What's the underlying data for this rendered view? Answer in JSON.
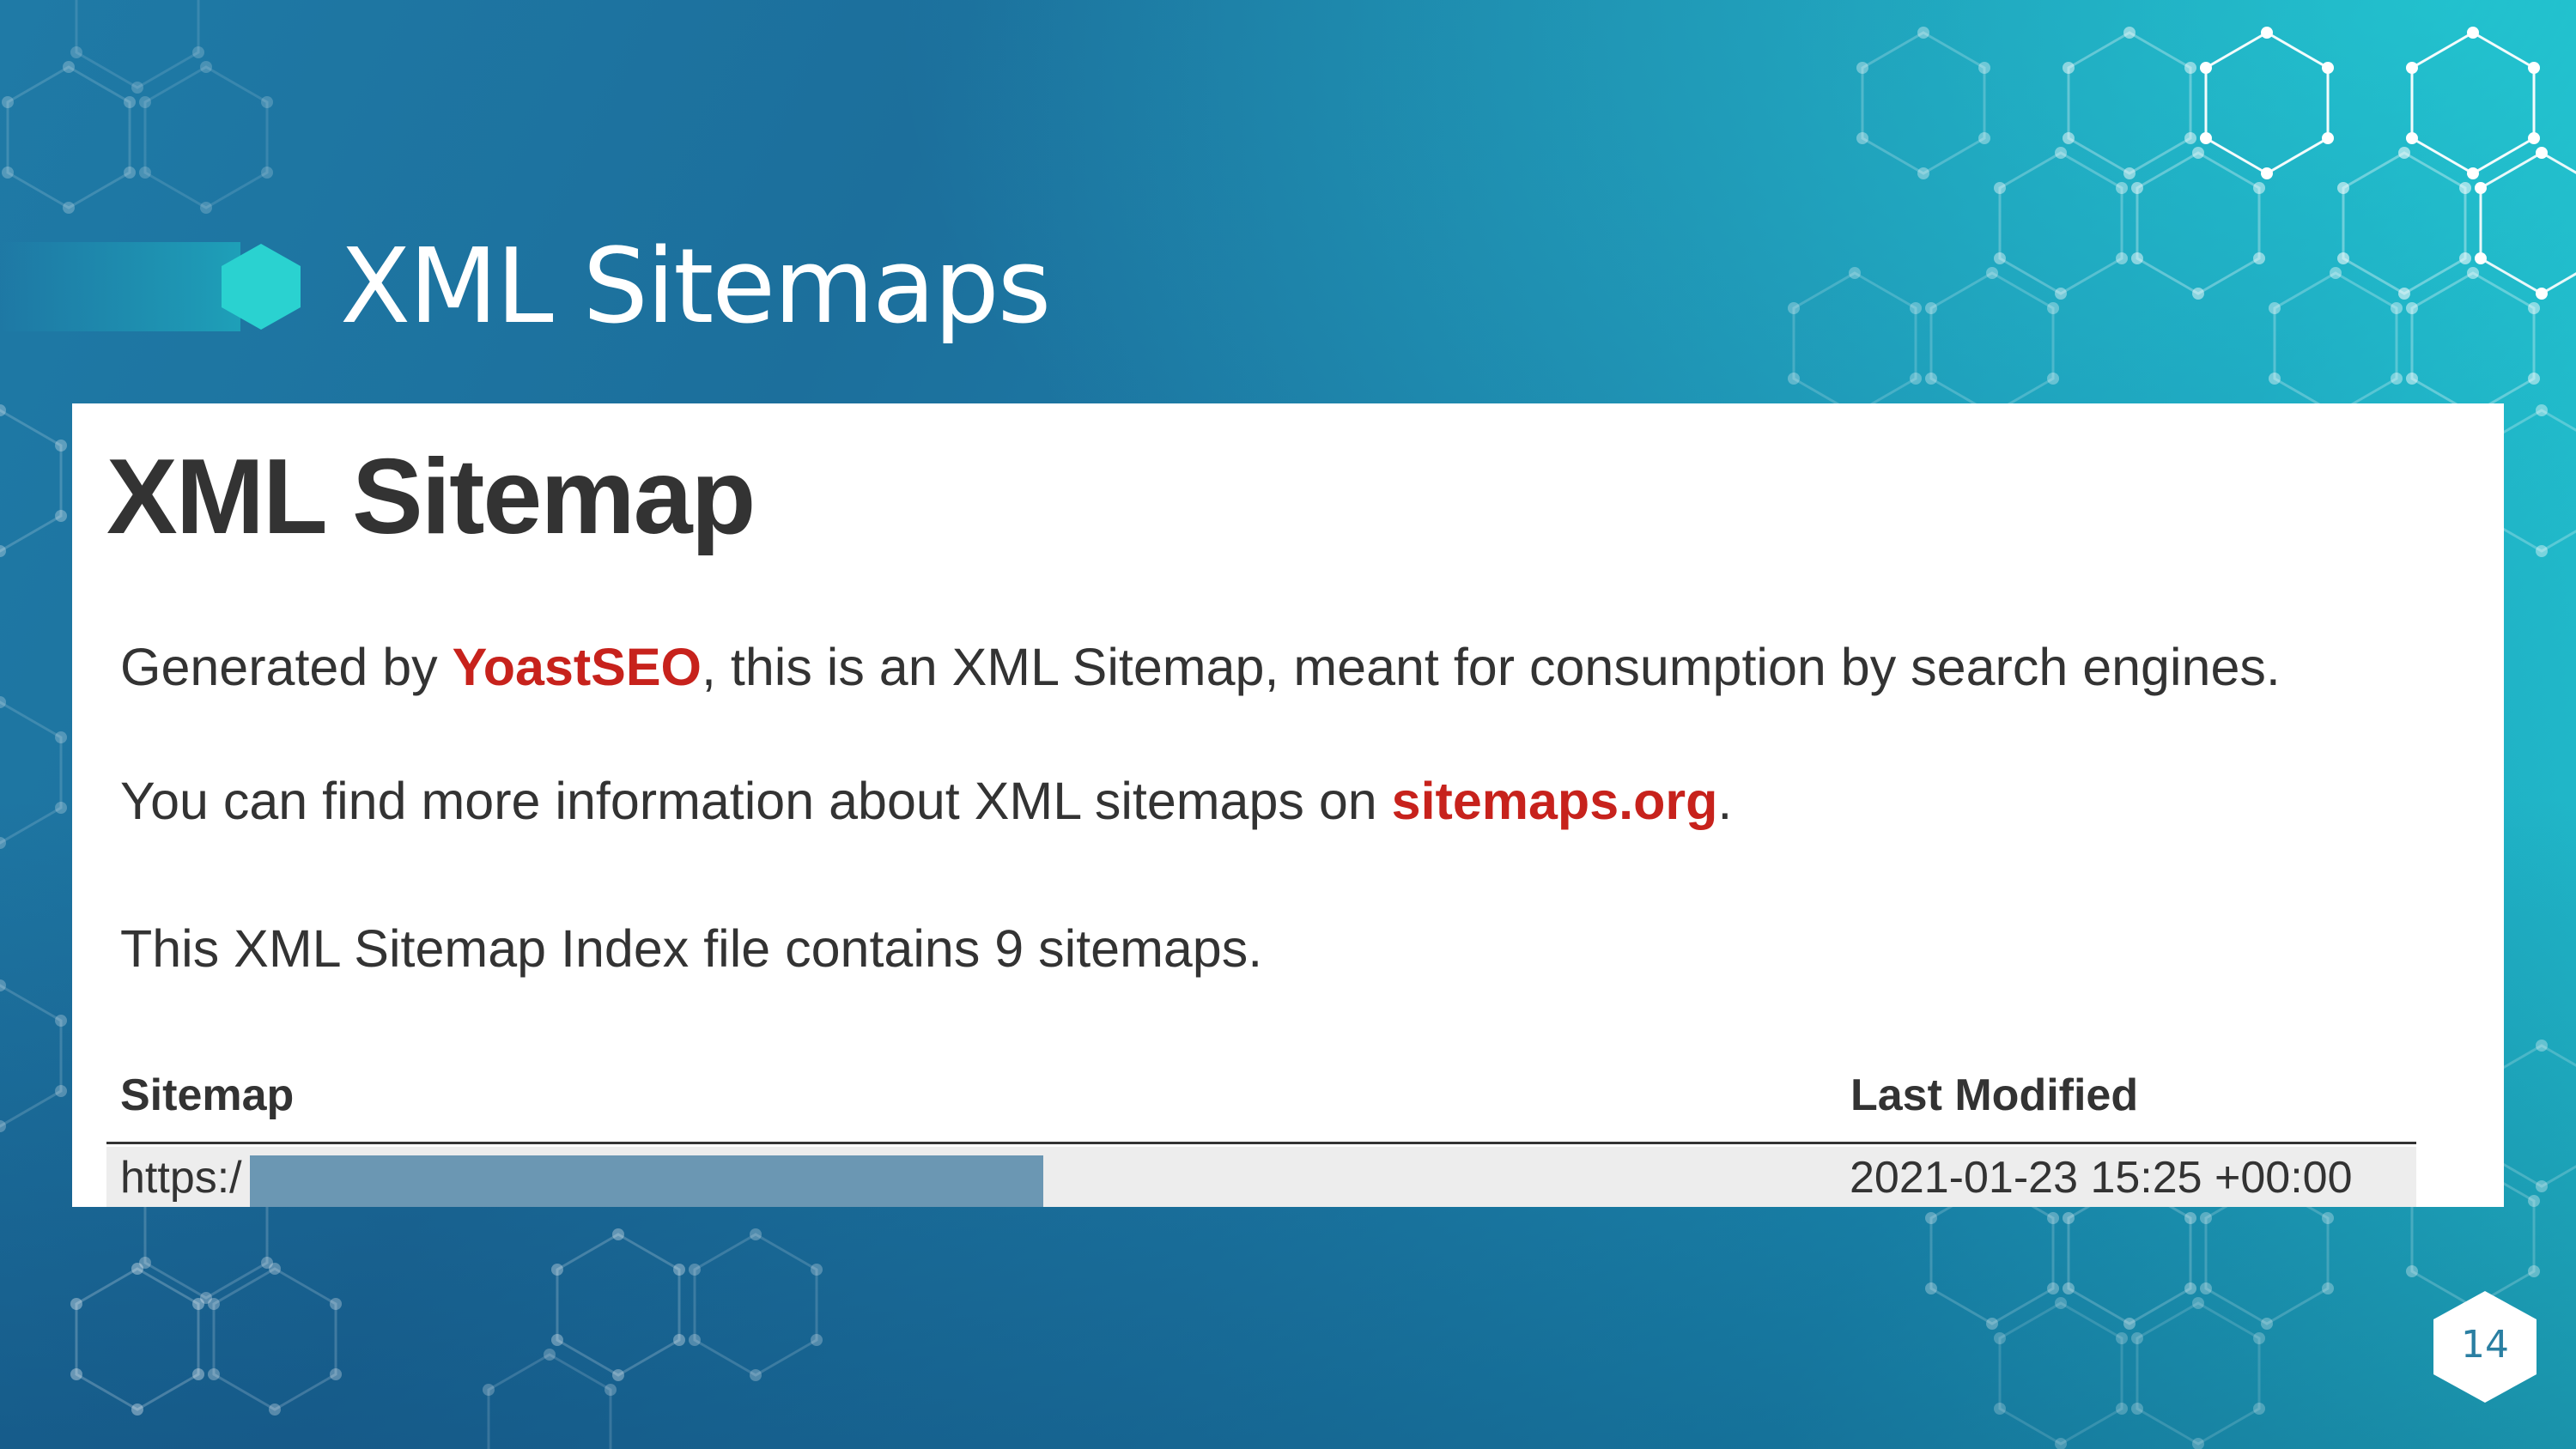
{
  "slide": {
    "title": "XML Sitemaps",
    "page_number": "14"
  },
  "screenshot": {
    "heading": "XML Sitemap",
    "line1": {
      "before": "Generated by ",
      "link": "YoastSEO",
      "after": ", this is an XML Sitemap, meant for consumption by search engines."
    },
    "line2": {
      "before": "You can find more information about XML sitemaps on ",
      "link": "sitemaps.org",
      "after": "."
    },
    "line3": "This XML Sitemap Index file contains 9 sitemaps.",
    "table": {
      "columns": [
        "Sitemap",
        "Last Modified"
      ],
      "rows": [
        {
          "sitemap": "https:/",
          "last_modified": "2021-01-23 15:25 +00:00"
        }
      ]
    }
  },
  "colors": {
    "link_red": "#c7221c",
    "accent_teal": "#22c6d0",
    "redaction": "#6b97b3"
  }
}
